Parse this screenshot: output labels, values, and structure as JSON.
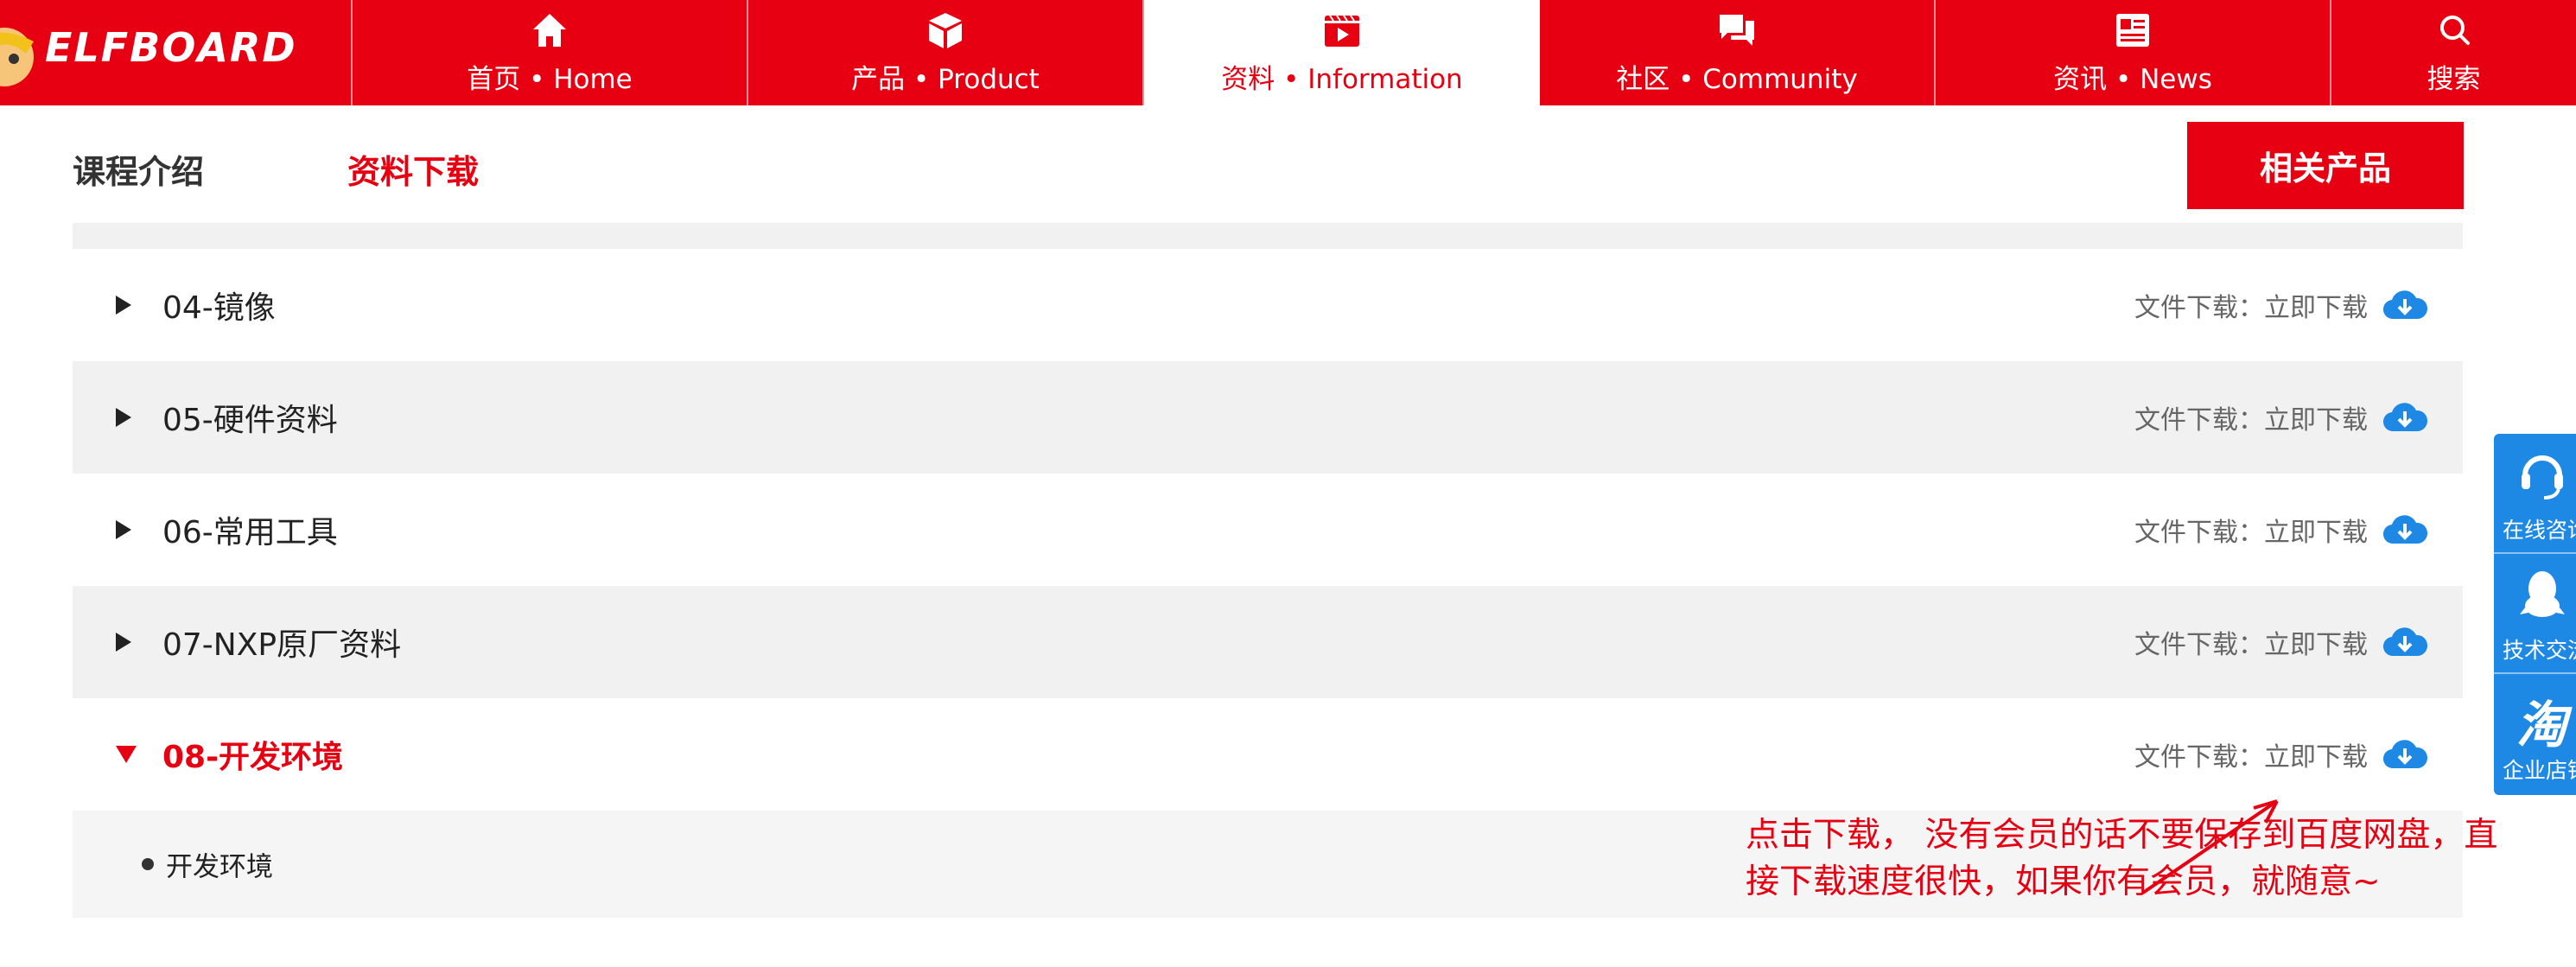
{
  "brand": {
    "logo_text": "ELFBOARD"
  },
  "nav": {
    "items": [
      {
        "label": "首页  •  Home",
        "icon": "home-icon"
      },
      {
        "label": "产品  •  Product",
        "icon": "box-icon"
      },
      {
        "label": "资料  •  Information",
        "icon": "video-icon",
        "active": true
      },
      {
        "label": "社区  •  Community",
        "icon": "chat-icon"
      },
      {
        "label": "资讯  •  News",
        "icon": "newspaper-icon"
      },
      {
        "label": "搜索",
        "icon": "search-icon"
      }
    ]
  },
  "tabs": {
    "intro": "课程介绍",
    "download": "资料下载",
    "related": "相关产品"
  },
  "list": {
    "download_prefix": "文件下载：",
    "download_link": "立即下载",
    "items": [
      {
        "title": "04-镜像"
      },
      {
        "title": "05-硬件资料"
      },
      {
        "title": "06-常用工具"
      },
      {
        "title": "07-NXP原厂资料"
      },
      {
        "title": "08-开发环境",
        "expanded": true
      }
    ],
    "sub_items": [
      {
        "title": "开发环境"
      }
    ]
  },
  "annotation": {
    "line1": "点击下载， 没有会员的话不要保存到百度网盘，直",
    "line2": "接下载速度很快，如果你有会员，就随意~"
  },
  "side": {
    "items": [
      {
        "label": "在线咨询",
        "icon": "headset-icon"
      },
      {
        "label": "技术交流",
        "icon": "qq-icon"
      },
      {
        "label": "企业店铺",
        "icon": "taobao-icon",
        "glyph": "淘"
      }
    ]
  },
  "colors": {
    "brand_red": "#e60012",
    "side_blue": "#1e88e5",
    "cloud_blue": "#1e88e5"
  }
}
